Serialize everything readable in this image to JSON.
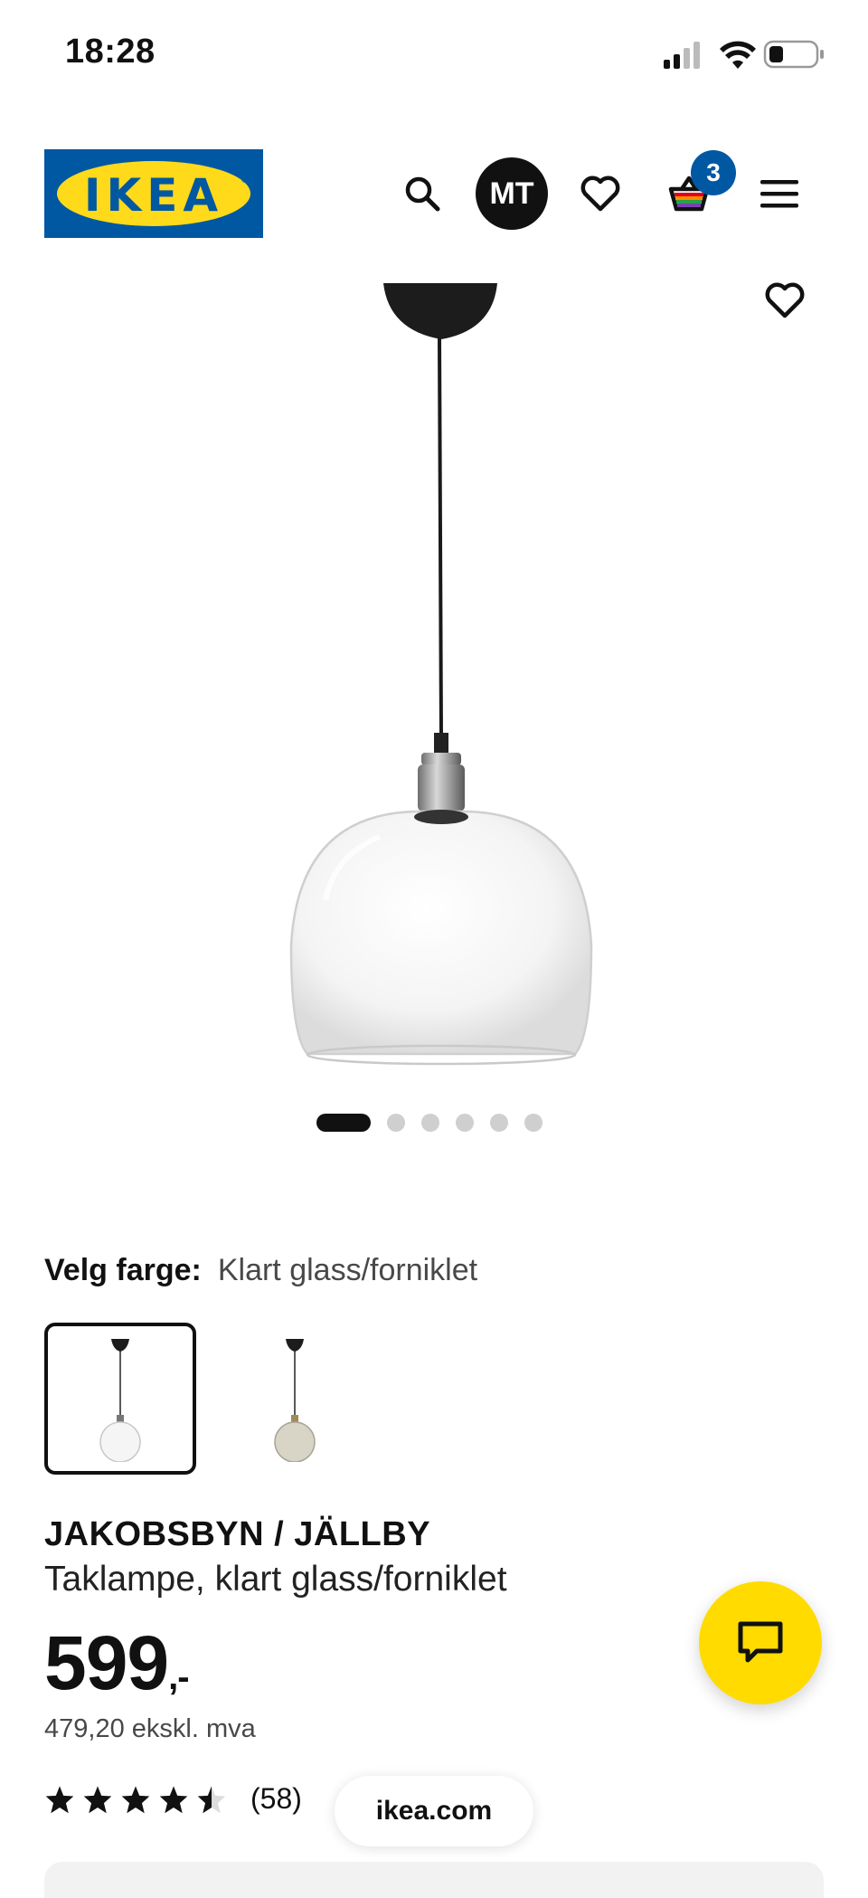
{
  "status_bar": {
    "time": "18:28",
    "signal_icon": "cell-signal-icon",
    "wifi_icon": "wifi-icon",
    "battery_icon": "battery-icon"
  },
  "header": {
    "logo_text": "IKEA",
    "search_icon": "search-icon",
    "avatar_initials": "MT",
    "wishlist_icon": "heart-icon",
    "cart_icon": "shopping-basket-icon",
    "cart_count": "3",
    "menu_icon": "hamburger-menu-icon",
    "brand_blue": "#0058a3",
    "brand_yellow": "#ffda1a"
  },
  "gallery": {
    "image_count": 6,
    "active_index": 0,
    "favorite_icon": "heart-outline-icon"
  },
  "color_picker": {
    "label": "Velg farge:",
    "selected_value": "Klart glass/forniklet",
    "options": [
      "clear-glass",
      "smoked-glass"
    ]
  },
  "product": {
    "name": "JAKOBSBYN / JÄLLBY",
    "description": "Taklampe, klart glass/forniklet",
    "price_main": "599",
    "price_suffix": ",-",
    "price_ex_vat": "479,20 ekskl. mva",
    "rating": 4.5,
    "rating_count": "(58)"
  },
  "browser": {
    "url": "ikea.com"
  },
  "chat": {
    "icon": "chat-bubble-icon",
    "color": "#ffdb00"
  }
}
